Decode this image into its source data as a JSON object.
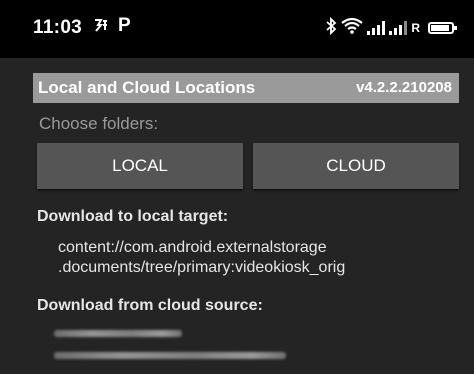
{
  "status_bar": {
    "time": "11:03",
    "left_icons": [
      "notification-icon",
      "parking-icon"
    ],
    "parking_glyph": "P",
    "right_icons": [
      "bluetooth-icon",
      "wifi-icon",
      "signal-icon",
      "signal-roaming-icon",
      "battery-icon"
    ],
    "roaming_label": "R"
  },
  "header": {
    "title": "Local and Cloud Locations",
    "version": "v4.2.2.210208"
  },
  "folders": {
    "prompt": "Choose folders:",
    "local_button": "LOCAL",
    "cloud_button": "CLOUD"
  },
  "local_target": {
    "heading": "Download to local target:",
    "path_line1": "content://com.android.externalstorage",
    "path_line2": ".documents/tree/primary:videokiosk_orig"
  },
  "cloud_source": {
    "heading": "Download from cloud source:"
  },
  "colors": {
    "background": "#242424",
    "status_bar": "#000000",
    "title_bar": "#9a9a9a",
    "button": "#555555",
    "text": "#e6e6e6",
    "muted_text": "#9a9a9a"
  }
}
